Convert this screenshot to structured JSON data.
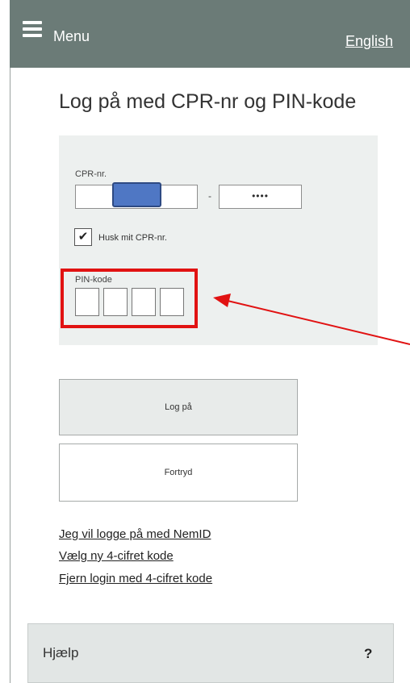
{
  "header": {
    "menu_label": "Menu",
    "language_link": "English"
  },
  "page": {
    "title": "Log på med CPR-nr og PIN-kode"
  },
  "form": {
    "cpr_label": "CPR-nr.",
    "cpr_first_value": "",
    "cpr_separator": "-",
    "cpr_second_value": "••••",
    "remember_checkbox": {
      "checked": true,
      "mark": "✔",
      "label": "Husk mit CPR-nr."
    },
    "pin_label": "PIN-kode",
    "pin_values": [
      "",
      "",
      "",
      ""
    ]
  },
  "buttons": {
    "login_label": "Log på",
    "cancel_label": "Fortryd"
  },
  "links": [
    "Jeg vil logge på med NemID",
    "Vælg ny 4-cifret kode",
    "Fjern login med 4-cifret kode"
  ],
  "help": {
    "label": "Hjælp",
    "icon_text": "?"
  },
  "colors": {
    "header_bg": "#6b7b77",
    "panel_bg": "#edf0ef",
    "highlight": "#e11212",
    "annotation_arrow": "#e11212",
    "mask": "#4f77c4"
  }
}
